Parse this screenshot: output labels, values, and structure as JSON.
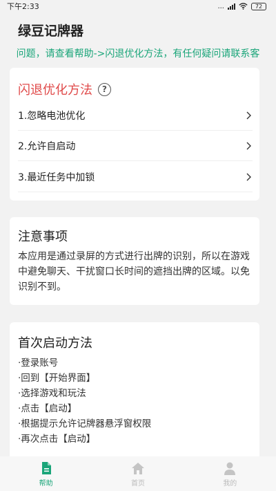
{
  "status_bar": {
    "time": "下午2:33",
    "signal_text": "...",
    "battery": "72"
  },
  "app_title": "绿豆记牌器",
  "notice": "问题，请查看帮助->闪退优化方法，有任何疑问请联系客",
  "optimize": {
    "title": "闪退优化方法",
    "help_icon": "?",
    "items": [
      {
        "label": "1.忽略电池优化"
      },
      {
        "label": "2.允许自启动"
      },
      {
        "label": "3.最近任务中加锁"
      }
    ]
  },
  "notes": {
    "title": "注意事项",
    "body": "本应用是通过录屏的方式进行出牌的识别，所以在游戏中避免聊天、干扰窗口长时间的遮挡出牌的区域。以免识别不到。"
  },
  "first_launch": {
    "title": "首次启动方法",
    "steps": [
      "·登录账号",
      "·回到【开始界面】",
      "·选择游戏和玩法",
      "·点击【启动】",
      "·根据提示允许记牌器悬浮窗权限",
      "·再次点击【启动】"
    ]
  },
  "tabs": [
    {
      "label": "帮助",
      "active": true,
      "icon": "document-icon"
    },
    {
      "label": "首页",
      "active": false,
      "icon": "home-icon"
    },
    {
      "label": "我的",
      "active": false,
      "icon": "user-icon"
    }
  ],
  "colors": {
    "accent": "#1aa579",
    "warning_title": "#e04a4a",
    "background": "#f2f2f2"
  }
}
